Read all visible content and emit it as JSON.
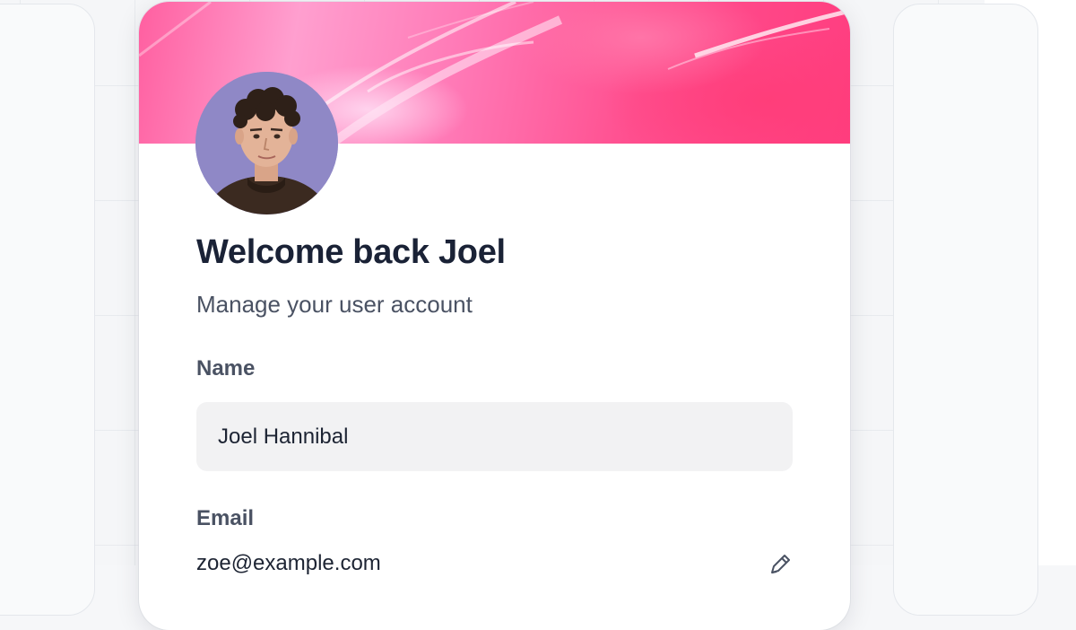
{
  "profile": {
    "heading": "Welcome back Joel",
    "subheading": "Manage your user account",
    "avatar_alt": "Profile photo of Joel",
    "banner_colors": [
      "#ff5fa0",
      "#ff9fcf",
      "#ff4f8f",
      "#ff3d7f"
    ]
  },
  "form": {
    "name_label": "Name",
    "name_value": "Joel Hannibal",
    "email_label": "Email",
    "email_value": "zoe@example.com",
    "email_edit_icon": "pencil-icon"
  },
  "colors": {
    "heading": "#1a2236",
    "label": "#4a5263",
    "input_bg": "#f2f2f3"
  }
}
